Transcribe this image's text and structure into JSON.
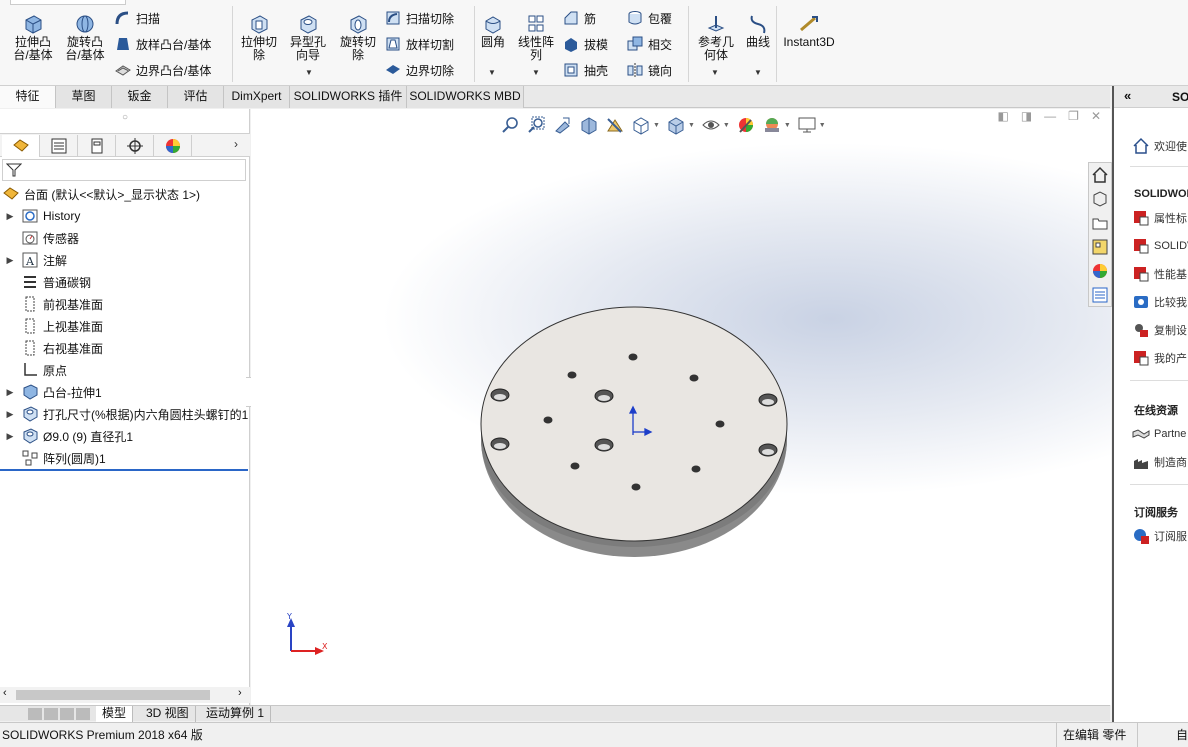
{
  "ribbon": {
    "extrude_boss": "拉伸凸\n台/基体",
    "revolve_boss": "旋转凸\n台/基体",
    "sweep": "扫描",
    "loft_boss": "放样凸台/基体",
    "boundary_boss": "边界凸台/基体",
    "extrude_cut": "拉伸切\n除",
    "hole_wizard": "异型孔\n向导",
    "revolve_cut": "旋转切\n除",
    "sweep_cut": "扫描切除",
    "loft_cut": "放样切割",
    "boundary_cut": "边界切除",
    "fillet": "圆角",
    "linear_pattern": "线性阵\n列",
    "rib": "筋",
    "draft": "拔模",
    "shell": "抽壳",
    "wrap": "包覆",
    "intersect": "相交",
    "mirror": "镜向",
    "ref_geometry": "参考几\n何体",
    "curves": "曲线",
    "instant3d": "Instant3D"
  },
  "tabs": [
    "特征",
    "草图",
    "钣金",
    "评估",
    "DimXpert",
    "SOLIDWORKS 插件",
    "SOLIDWORKS MBD"
  ],
  "tree": {
    "root": "台面  (默认<<默认>_显示状态 1>)",
    "items": [
      {
        "label": "History",
        "expandable": true
      },
      {
        "label": "传感器",
        "expandable": false
      },
      {
        "label": "注解",
        "expandable": true
      },
      {
        "label": "普通碳钢",
        "expandable": false
      },
      {
        "label": "前视基准面",
        "expandable": false
      },
      {
        "label": "上视基准面",
        "expandable": false
      },
      {
        "label": "右视基准面",
        "expandable": false
      },
      {
        "label": "原点",
        "expandable": false
      },
      {
        "label": "凸台-拉伸1",
        "expandable": true
      },
      {
        "label": "打孔尺寸(%根据)内六角圆柱头螺钉的1",
        "expandable": true
      },
      {
        "label": "Ø9.0 (9) 直径孔1",
        "expandable": true
      },
      {
        "label": "阵列(圆周)1",
        "expandable": false
      }
    ]
  },
  "bottom_tabs": [
    "模型",
    "3D 视图",
    "运动算例 1"
  ],
  "triad": {
    "x": "X",
    "y": "Y"
  },
  "right_panel": {
    "header": "SO",
    "welcome": "欢迎使",
    "section1": "SOLIDWOR",
    "items1": [
      "属性标",
      "SOLIDV",
      "性能基",
      "比较我",
      "复制设",
      "我的产"
    ],
    "section2": "在线资源",
    "items2": [
      "Partne",
      "制造商"
    ],
    "section3": "订阅服务",
    "items3": [
      "订阅服"
    ]
  },
  "status": {
    "left": "SOLIDWORKS Premium 2018 x64 版",
    "mode": "在编辑 零件",
    "custom": "自"
  },
  "colors": {
    "accent": "#2a66c7",
    "plate_top": "#e9e6e2",
    "plate_side": "#8a8a8a"
  }
}
